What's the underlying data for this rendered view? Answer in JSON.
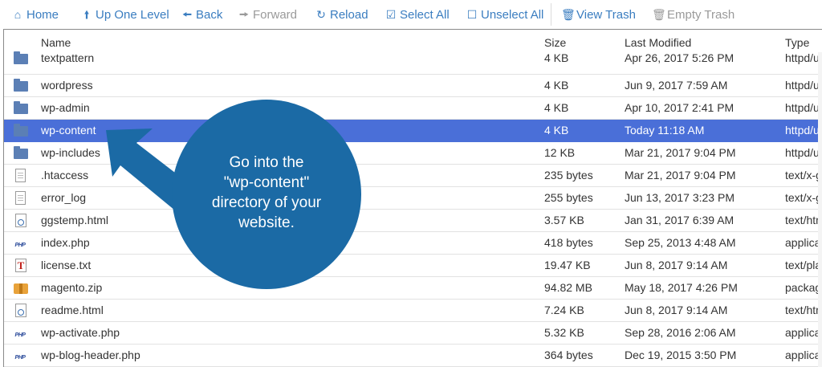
{
  "toolbar": {
    "home": "Home",
    "up_one_level": "Up One Level",
    "back": "Back",
    "forward": "Forward",
    "reload": "Reload",
    "select_all": "Select All",
    "unselect_all": "Unselect All",
    "view_trash": "View Trash",
    "empty_trash": "Empty Trash"
  },
  "columns": {
    "name": "Name",
    "size": "Size",
    "last_modified": "Last Modified",
    "type": "Type"
  },
  "files": [
    {
      "icon": "folder-icon",
      "name": "textpattern",
      "size": "4 KB",
      "modified": "Apr 26, 2017 5:26 PM",
      "type": "httpd/u"
    },
    {
      "icon": "folder-icon",
      "name": "wordpress",
      "size": "4 KB",
      "modified": "Jun 9, 2017 7:59 AM",
      "type": "httpd/u"
    },
    {
      "icon": "folder-icon",
      "name": "wp-admin",
      "size": "4 KB",
      "modified": "Apr 10, 2017 2:41 PM",
      "type": "httpd/u"
    },
    {
      "icon": "folder-icon",
      "name": "wp-content",
      "size": "4 KB",
      "modified": "Today 11:18 AM",
      "type": "httpd/u",
      "selected": true
    },
    {
      "icon": "folder-icon",
      "name": "wp-includes",
      "size": "12 KB",
      "modified": "Mar 21, 2017 9:04 PM",
      "type": "httpd/u"
    },
    {
      "icon": "text-file-icon",
      "name": ".htaccess",
      "size": "235 bytes",
      "modified": "Mar 21, 2017 9:04 PM",
      "type": "text/x-g"
    },
    {
      "icon": "text-file-icon",
      "name": "error_log",
      "size": "255 bytes",
      "modified": "Jun 13, 2017 3:23 PM",
      "type": "text/x-g"
    },
    {
      "icon": "html-file-icon",
      "name": "ggstemp.html",
      "size": "3.57 KB",
      "modified": "Jan 31, 2017 6:39 AM",
      "type": "text/htm"
    },
    {
      "icon": "php-file-icon",
      "name": "index.php",
      "size": "418 bytes",
      "modified": "Sep 25, 2013 4:48 AM",
      "type": "applica"
    },
    {
      "icon": "txt-file-icon",
      "name": "license.txt",
      "size": "19.47 KB",
      "modified": "Jun 8, 2017 9:14 AM",
      "type": "text/pla"
    },
    {
      "icon": "zip-file-icon",
      "name": "magento.zip",
      "size": "94.82 MB",
      "modified": "May 18, 2017 4:26 PM",
      "type": "packag"
    },
    {
      "icon": "html-file-icon",
      "name": "readme.html",
      "size": "7.24 KB",
      "modified": "Jun 8, 2017 9:14 AM",
      "type": "text/htm"
    },
    {
      "icon": "php-file-icon",
      "name": "wp-activate.php",
      "size": "5.32 KB",
      "modified": "Sep 28, 2016 2:06 AM",
      "type": "applica"
    },
    {
      "icon": "php-file-icon",
      "name": "wp-blog-header.php",
      "size": "364 bytes",
      "modified": "Dec 19, 2015 3:50 PM",
      "type": "applica"
    }
  ],
  "callout": {
    "line1": "Go into the",
    "line2": "\"wp-content\"",
    "line3": "directory of your",
    "line4": "website.",
    "color": "#1b6aa5"
  },
  "colors": {
    "accent": "#3a7dc0",
    "selected_row": "#4a6fd8",
    "disabled": "#9a9a9a"
  }
}
